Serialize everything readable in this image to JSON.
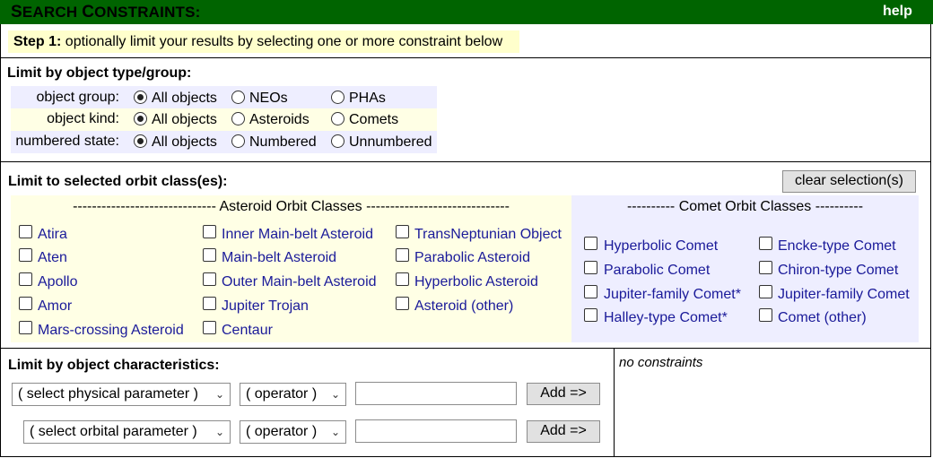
{
  "header": {
    "title_first": "S",
    "title_rest": "EARCH ",
    "title_second": "C",
    "title_rest2": "ONSTRAINTS:",
    "help": "help"
  },
  "step": {
    "label": "Step 1:",
    "text": " optionally limit your results by selecting one or more constraint below"
  },
  "type_group": {
    "title": "Limit by object type/group:",
    "rows": [
      {
        "label": "object group:",
        "options": [
          "All objects",
          "NEOs",
          "PHAs"
        ],
        "selected": 0
      },
      {
        "label": "object kind:",
        "options": [
          "All objects",
          "Asteroids",
          "Comets"
        ],
        "selected": 0
      },
      {
        "label": "numbered state:",
        "options": [
          "All objects",
          "Numbered",
          "Unnumbered"
        ],
        "selected": 0
      }
    ]
  },
  "orbit": {
    "title": "Limit to selected orbit class(es):",
    "clear_button": "clear selection(s)",
    "asteroid_header": "------------------------------ Asteroid Orbit Classes ------------------------------",
    "comet_header": "---------- Comet Orbit Classes ----------",
    "asteroid_col1": [
      "Atira",
      "Aten",
      "Apollo",
      "Amor",
      "Mars-crossing Asteroid"
    ],
    "asteroid_col2": [
      "Inner Main-belt Asteroid",
      "Main-belt Asteroid",
      "Outer Main-belt Asteroid",
      "Jupiter Trojan",
      "Centaur"
    ],
    "asteroid_col3": [
      "TransNeptunian Object",
      "Parabolic Asteroid",
      "Hyperbolic Asteroid",
      "Asteroid (other)"
    ],
    "comet_col1": [
      "Hyperbolic Comet",
      "Parabolic Comet",
      "Jupiter-family Comet*",
      "Halley-type Comet*"
    ],
    "comet_col2": [
      "Encke-type Comet",
      "Chiron-type Comet",
      "Jupiter-family Comet",
      "Comet (other)"
    ]
  },
  "characteristics": {
    "title": "Limit by object characteristics:",
    "physical_select": "( select physical parameter )",
    "orbital_select": "( select orbital parameter )",
    "operator": "( operator )",
    "add_button": "Add =>",
    "constraints_status": "no constraints"
  },
  "colors": {
    "header": "#006400",
    "step_bg": "#ffffcc",
    "asteroid_bg": "#ffffe5",
    "comet_bg": "#eeeeff",
    "link": "#1a1a99"
  }
}
